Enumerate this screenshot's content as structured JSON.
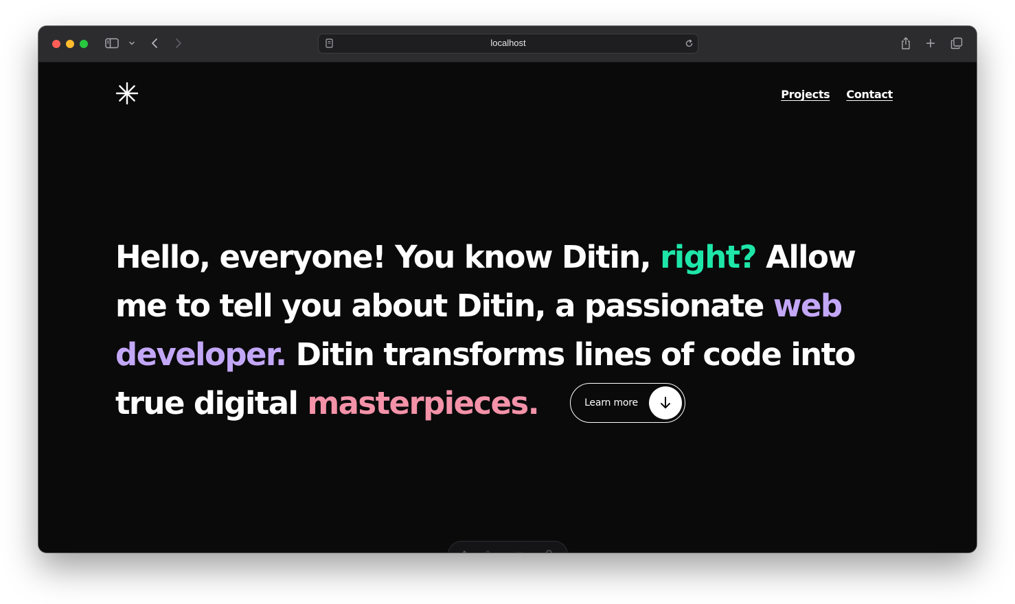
{
  "browser": {
    "url": "localhost",
    "icons": {
      "sidebar": "sidebar-icon",
      "chevron": "chevron-down-icon",
      "back": "back-arrow-icon",
      "forward": "forward-arrow-icon",
      "page": "page-icon",
      "reload": "reload-icon",
      "share": "share-icon",
      "new_tab": "plus-icon",
      "tabs": "tab-overview-icon"
    }
  },
  "site": {
    "logo_icon": "asterisk-icon",
    "nav": [
      {
        "label": "Projects"
      },
      {
        "label": "Contact"
      }
    ],
    "hero": {
      "part1": "Hello, everyone! You know Ditin, ",
      "accent1": "right?",
      "part2": " Allow me to tell you about Ditin, a passionate ",
      "accent2": "web developer.",
      "part3": " Ditin transforms lines of code into true digital ",
      "accent3": "masterpieces."
    },
    "cta": {
      "label": "Learn more",
      "icon": "arrow-down-icon"
    }
  },
  "colors": {
    "background": "#0a0a0b",
    "text": "#ffffff",
    "accent_green": "#1ee6a8",
    "accent_purple": "#c3a7f7",
    "accent_pink": "#f392a8"
  }
}
